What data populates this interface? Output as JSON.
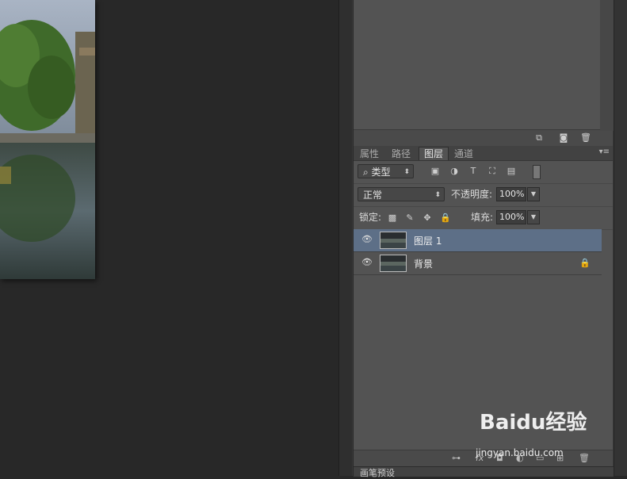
{
  "panel_tabs": [
    "属性",
    "路径",
    "图层",
    "通道"
  ],
  "active_tab": "图层",
  "filter": {
    "kind_label": "类型"
  },
  "blend": {
    "mode": "正常",
    "opacity_label": "不透明度:",
    "opacity_value": "100%"
  },
  "lock": {
    "label": "锁定:",
    "fill_label": "填充:",
    "fill_value": "100%"
  },
  "layers": [
    {
      "name": "图层 1",
      "selected": true,
      "locked": false
    },
    {
      "name": "背景",
      "selected": false,
      "locked": true
    }
  ],
  "bottom_panel": {
    "label": "画笔预设"
  },
  "watermark": {
    "main": "Baidu经验",
    "sub": "jingyan.baidu.com"
  },
  "colors": {
    "selected_layer": "#5d6f87",
    "panel_bg": "#535353",
    "arrow": "#e03a3a"
  },
  "icons": [
    "search-icon",
    "image-filter-icon",
    "adjust-filter-icon",
    "text-filter-icon",
    "shape-filter-icon",
    "smart-object-filter-icon",
    "filter-toggle-icon",
    "eye-icon",
    "lock-icon",
    "link-icon",
    "fx-icon",
    "mask-icon",
    "new-layer-icon",
    "trash-icon",
    "camera-icon"
  ]
}
